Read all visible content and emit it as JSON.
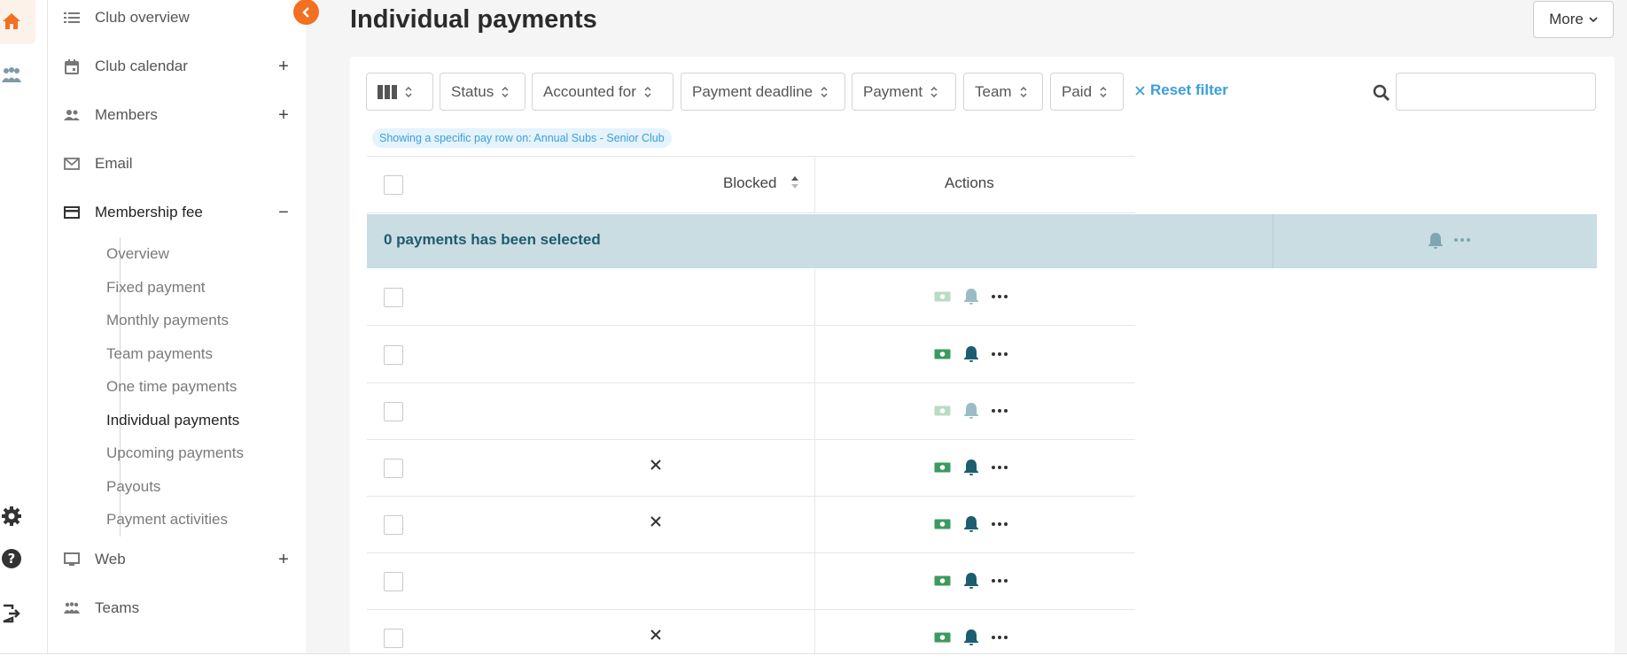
{
  "page": {
    "title": "Individual payments",
    "more_label": "More"
  },
  "sidebar": {
    "items": [
      {
        "label": "Club overview",
        "icon": "list-icon",
        "toggle": ""
      },
      {
        "label": "Club calendar",
        "icon": "calendar-icon",
        "toggle": "+"
      },
      {
        "label": "Members",
        "icon": "members-icon",
        "toggle": "+"
      },
      {
        "label": "Email",
        "icon": "mail-icon",
        "toggle": ""
      },
      {
        "label": "Membership fee",
        "icon": "card-icon",
        "toggle": "−"
      },
      {
        "label": "Web",
        "icon": "monitor-icon",
        "toggle": "+"
      },
      {
        "label": "Teams",
        "icon": "teams-icon",
        "toggle": ""
      }
    ],
    "sub_items": [
      "Overview",
      "Fixed payment",
      "Monthly payments",
      "Team payments",
      "One time payments",
      "Individual payments",
      "Upcoming payments",
      "Payouts",
      "Payment activities"
    ],
    "current_sub": "Individual payments"
  },
  "filters": {
    "columns_icon": "columns-icon",
    "items": [
      "Status",
      "Accounted for",
      "Payment deadline",
      "Payment",
      "Team",
      "Paid"
    ],
    "reset_label": "Reset filter",
    "search_placeholder": ""
  },
  "chip": {
    "text": "Showing a specific pay row on: Annual Subs - Senior Club"
  },
  "table": {
    "headers": {
      "blocked": "Blocked",
      "actions": "Actions"
    },
    "selection_text": "0 payments has been selected",
    "rows": [
      {
        "blocked": false,
        "active": false
      },
      {
        "blocked": false,
        "active": true
      },
      {
        "blocked": false,
        "active": false
      },
      {
        "blocked": true,
        "active": true
      },
      {
        "blocked": true,
        "active": true
      },
      {
        "blocked": false,
        "active": true
      },
      {
        "blocked": true,
        "active": true
      }
    ]
  },
  "colors": {
    "accent": "#f36f21",
    "link": "#3b9fd8",
    "selection_bg": "#c9dde3",
    "bell": "#1d5d70",
    "cash": "#3c9a5f"
  }
}
